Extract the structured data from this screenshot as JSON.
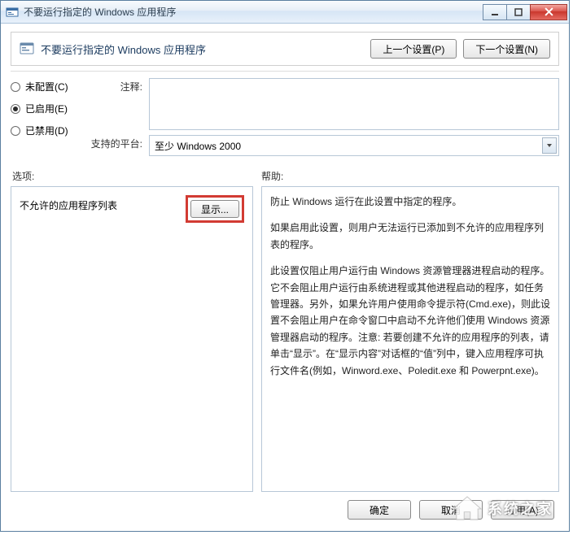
{
  "window": {
    "title": "不要运行指定的 Windows 应用程序"
  },
  "header": {
    "title": "不要运行指定的 Windows 应用程序",
    "prev_btn": "上一个设置(P)",
    "next_btn": "下一个设置(N)"
  },
  "radios": {
    "unconfigured": "未配置(C)",
    "enabled": "已启用(E)",
    "disabled": "已禁用(D)",
    "selected": "enabled"
  },
  "fields": {
    "comment_label": "注释:",
    "comment_value": "",
    "platform_label": "支持的平台:",
    "platform_value": "至少 Windows 2000"
  },
  "sections": {
    "options_label": "选项:",
    "help_label": "帮助:"
  },
  "options": {
    "list_label": "不允许的应用程序列表",
    "show_btn": "显示..."
  },
  "help": {
    "p1": "防止 Windows 运行在此设置中指定的程序。",
    "p2": "如果启用此设置，则用户无法运行已添加到不允许的应用程序列表的程序。",
    "p3": "此设置仅阻止用户运行由 Windows 资源管理器进程启动的程序。它不会阻止用户运行由系统进程或其他进程启动的程序，如任务管理器。另外，如果允许用户使用命令提示符(Cmd.exe)，则此设置不会阻止用户在命令窗口中启动不允许他们使用 Windows 资源管理器启动的程序。注意: 若要创建不允许的应用程序的列表，请单击“显示”。在“显示内容”对话框的“值”列中，键入应用程序可执行文件名(例如，Winword.exe、Poledit.exe 和 Powerpnt.exe)。"
  },
  "footer": {
    "ok": "确定",
    "cancel": "取消",
    "apply": "应用(A)"
  },
  "watermark": {
    "text": "系统之家"
  }
}
